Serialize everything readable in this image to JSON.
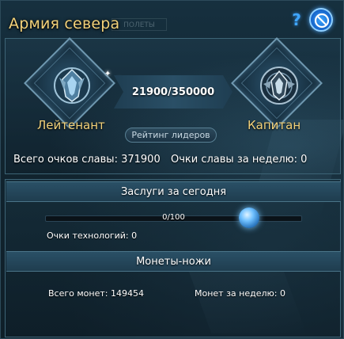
{
  "window": {
    "title": "Армия севера",
    "ghost_tab": "ПОЛЕТЫ"
  },
  "controls": {
    "help_label": "?"
  },
  "rank": {
    "current": "Лейтенант",
    "next": "Капитан",
    "progress_text": "21900/350000",
    "progress_current": 21900,
    "progress_max": 350000,
    "leaders_button": "Рейтинг лидеров"
  },
  "glory": {
    "total_label": "Всего очков славы:",
    "total_value": "371900",
    "weekly_label": "Очки славы за неделю:",
    "weekly_value": "0"
  },
  "merits": {
    "header": "Заслуги за сегодня",
    "progress_text": "0/100",
    "progress_fraction": 0.0,
    "tech_label": "Очки технологий:",
    "tech_value": "0"
  },
  "coins": {
    "header": "Монеты-ножи",
    "total_label": "Всего монет:",
    "total_value": "149454",
    "weekly_label": "Монет за неделю:",
    "weekly_value": "0"
  },
  "colors": {
    "gold": "#f3d27a",
    "accent_blue": "#3fa6ff"
  }
}
